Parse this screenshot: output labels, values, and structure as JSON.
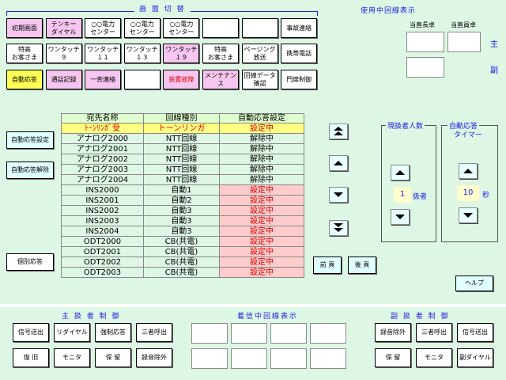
{
  "top_switch": {
    "title": "画 面 切 替",
    "row1": [
      "初期画面",
      "テンキー\nダイヤル",
      "○○電力\nセンター",
      "○○電力\nセンター",
      "○○電力\nセンター",
      "",
      "",
      "事故連絡"
    ],
    "row2": [
      "特高\nお客さま",
      "ワンタッチ\n９",
      "ワンタッチ\n１１",
      "ワンタッチ\n１３",
      "ワンタッチ\n１９",
      "特高\nお客さま",
      "ページング\n放送",
      "携帯電話"
    ],
    "row3": [
      "自動応答",
      "通話記録",
      "一斉連絡",
      "",
      "装置故障",
      "メンテナン\nス",
      "回線データ\n確認",
      "門扉制御"
    ]
  },
  "in_use": {
    "title": "使用中回線表示",
    "head_desk": "当直長卓",
    "staff_desk": "当直員卓",
    "main_label": "主",
    "sub_label": "副"
  },
  "left_buttons": {
    "auto_setting": "自動応答設定",
    "auto_release": "自動応答解除",
    "individual": "個別応答"
  },
  "table": {
    "headers": [
      "宛先名称",
      "回線種別",
      "自動応答設定"
    ],
    "subheader": [
      "ﾄｰﾝﾘﾝｶﾞ受",
      "トーンリンガ",
      "設定中"
    ],
    "rows": [
      [
        "アナログ2000",
        "NTT回線",
        "解除中",
        false
      ],
      [
        "アナログ2001",
        "NTT回線",
        "解除中",
        false
      ],
      [
        "アナログ2002",
        "NTT回線",
        "解除中",
        false
      ],
      [
        "アナログ2003",
        "NTT回線",
        "解除中",
        false
      ],
      [
        "アナログ2004",
        "NTT回線",
        "解除中",
        false
      ],
      [
        "INS2000",
        "自動1",
        "設定中",
        true
      ],
      [
        "INS2001",
        "自動2",
        "設定中",
        true
      ],
      [
        "INS2002",
        "自動3",
        "設定中",
        true
      ],
      [
        "INS2003",
        "自動3",
        "設定中",
        true
      ],
      [
        "INS2004",
        "自動3",
        "設定中",
        true
      ],
      [
        "ODT2000",
        "CB(共電)",
        "設定中",
        true
      ],
      [
        "ODT2001",
        "CB(共電)",
        "設定中",
        true
      ],
      [
        "ODT2002",
        "CB(共電)",
        "設定中",
        true
      ],
      [
        "ODT2003",
        "CB(共電)",
        "設定中",
        true
      ]
    ]
  },
  "paging": {
    "prev": "前 頁",
    "next": "後 頁"
  },
  "present_people": {
    "title": "現扱者人数",
    "value": "1",
    "unit": "扱者"
  },
  "auto_timer": {
    "title1": "自動応答",
    "title2": "タイマー",
    "value": "10",
    "unit": "秒"
  },
  "help": "ヘルプ",
  "main_ctrl": {
    "title": "主 扱 者 制 御",
    "row1": [
      "信号送出",
      "リダイヤル",
      "強制応答",
      "三者呼出"
    ],
    "row2": [
      "復 旧",
      "モニタ",
      "保 留",
      "録音除外"
    ]
  },
  "incoming": {
    "title": "着信中回線表示"
  },
  "sub_ctrl": {
    "title": "副 扱 者 制 御",
    "row1": [
      "録音除外",
      "三者呼出",
      "信号送出"
    ],
    "row2": [
      "保 留",
      "モニタ",
      "副ダイヤル"
    ]
  },
  "colors": {
    "panel": "#ddf7e4",
    "pink": "#f7c6f0",
    "yellow": "#ffff55",
    "set_row": "#ffcccc"
  }
}
